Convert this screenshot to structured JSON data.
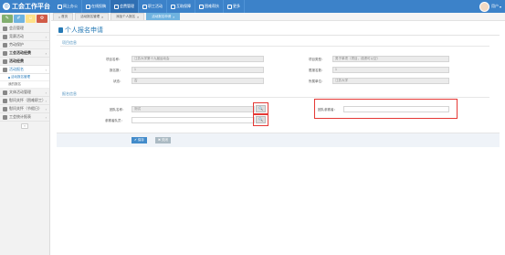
{
  "app": {
    "title": "工会工作平台",
    "user_name": "用户",
    "logo_glyph": "◎"
  },
  "topnav": [
    {
      "label": "网上办公",
      "active": false
    },
    {
      "label": "在线投稿",
      "active": false
    },
    {
      "label": "会费管理",
      "active": true
    },
    {
      "label": "职工活动",
      "active": false
    },
    {
      "label": "互助保障",
      "active": false
    },
    {
      "label": "困难帮扶",
      "active": false
    },
    {
      "label": "更多",
      "active": false
    }
  ],
  "shortcuts": [
    {
      "glyph": "✎",
      "color": "#82af6f"
    },
    {
      "glyph": "✐",
      "color": "#6fb3e0"
    },
    {
      "glyph": "☺",
      "color": "#fee188"
    },
    {
      "glyph": "⚙",
      "color": "#d15b47"
    }
  ],
  "sidebar": {
    "items": [
      {
        "label": "会员管理",
        "bold": false,
        "arrow": ""
      },
      {
        "label": "竞赛活动",
        "bold": false,
        "arrow": "›"
      },
      {
        "label": "劳动保护",
        "bold": false,
        "arrow": ""
      },
      {
        "label": "工会活动经费",
        "bold": true,
        "arrow": "›"
      },
      {
        "label": "活动经费",
        "bold": true,
        "arrow": ""
      },
      {
        "label": "活动报名",
        "bold": false,
        "arrow": "‹"
      }
    ],
    "sub_items": [
      {
        "label": "活动报名管理",
        "active": true
      },
      {
        "label": "我的报名",
        "active": false
      }
    ],
    "items_after": [
      {
        "label": "文体活动管理",
        "arrow": "›"
      },
      {
        "label": "慰问关怀（困难职工）",
        "arrow": "›"
      },
      {
        "label": "慰问关怀（节假日）",
        "arrow": "›"
      },
      {
        "label": "工会统计报表",
        "arrow": "›"
      }
    ],
    "collapse_glyph": "«"
  },
  "tabs": [
    {
      "label": "首页",
      "active": false,
      "home": "⌂",
      "close": ""
    },
    {
      "label": "活动报名管理",
      "active": false,
      "home": "",
      "close": "×"
    },
    {
      "label": "添加个人报名",
      "active": false,
      "home": "",
      "close": "×"
    },
    {
      "label": "活动报名申请",
      "active": true,
      "home": "",
      "close": "×"
    }
  ],
  "page": {
    "title": "个人报名申请",
    "section1": "项目信息",
    "section2": "报名信息",
    "fields": {
      "project_name_label": "项目名称：",
      "project_name_value": "江苏大学第十九届运动会",
      "project_type_label": "项目类型：",
      "project_type_value": "男子单项（项目，成绩可以空）",
      "sign_count_label": "报名数：",
      "sign_count_value": "1",
      "limit_count_label": "限报名数：",
      "limit_count_value": "1",
      "status_label": "状态：",
      "status_value": "否",
      "org_label": "所属单位：",
      "org_value": "江苏大学",
      "team_name_label": "团队名称：",
      "team_name_value": "测试",
      "team_member_label": "团队参赛者：",
      "team_member_value": "",
      "participant_label": "参赛者队员：",
      "participant_value": ""
    },
    "search_glyph": "🔍",
    "save_label": "✔ 保存",
    "close_label": "✖ 关闭"
  }
}
